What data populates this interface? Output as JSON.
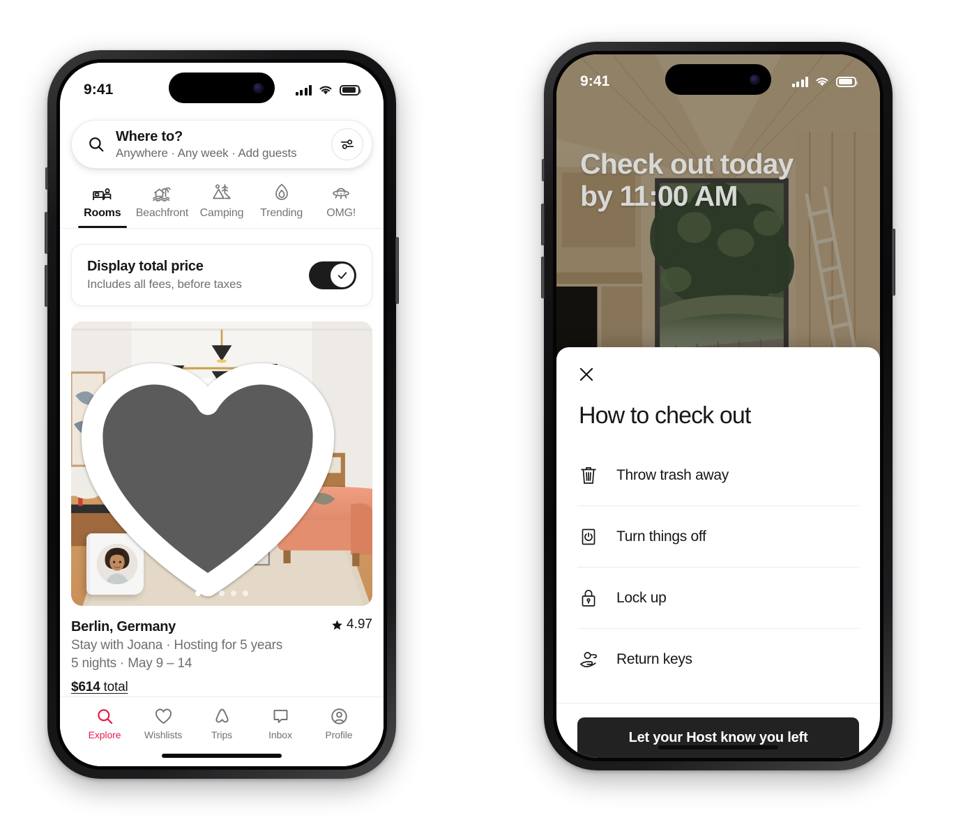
{
  "theme": {
    "brand": "#E61E4D",
    "ink": "#171717",
    "muted": "#6f6f6f",
    "cta_bg": "#222222"
  },
  "left_phone": {
    "status": {
      "time": "9:41",
      "signal_icon": "cellular-bars-icon",
      "wifi_icon": "wifi-icon",
      "battery_icon": "battery-icon"
    },
    "search": {
      "icon": "search-icon",
      "title": "Where to?",
      "subtitle": "Anywhere · Any week · Add guests",
      "filter_icon": "filter-sliders-icon"
    },
    "categories": [
      {
        "label": "Rooms",
        "icon": "bed-room-icon",
        "active": true
      },
      {
        "label": "Beachfront",
        "icon": "beachfront-icon",
        "active": false
      },
      {
        "label": "Camping",
        "icon": "camping-tent-icon",
        "active": false
      },
      {
        "label": "Trending",
        "icon": "flame-icon",
        "active": false
      },
      {
        "label": "OMG!",
        "icon": "ufo-icon",
        "active": false
      }
    ],
    "total_price_card": {
      "title": "Display total price",
      "subtitle": "Includes all fees, before taxes",
      "toggle_on": true,
      "toggle_icon": "check-icon"
    },
    "listing": {
      "photo_alt": "berlin-living-room-photo",
      "favorite_icon": "heart-filled-icon",
      "host_avatar": "host-avatar",
      "carousel_dots": 5,
      "carousel_active_index": 0,
      "place": "Berlin, Germany",
      "rating": "4.97",
      "rating_icon": "star-icon",
      "host_line": "Stay with Joana · Hosting for 5 years",
      "nights_line": "5 nights · May 9 – 14",
      "price_amount": "$614",
      "price_suffix": " total"
    },
    "tabs": [
      {
        "label": "Explore",
        "icon": "search-icon",
        "active": true
      },
      {
        "label": "Wishlists",
        "icon": "heart-outline-icon",
        "active": false
      },
      {
        "label": "Trips",
        "icon": "airbnb-belo-icon",
        "active": false
      },
      {
        "label": "Inbox",
        "icon": "chat-bubble-icon",
        "active": false
      },
      {
        "label": "Profile",
        "icon": "user-circle-icon",
        "active": false
      }
    ]
  },
  "right_phone": {
    "status": {
      "time": "9:41",
      "signal_icon": "cellular-bars-icon",
      "wifi_icon": "wifi-icon",
      "battery_icon": "battery-icon"
    },
    "background_alt": "cabin-interior-photo",
    "headline_line1": "Check out today",
    "headline_line2": "by 11:00 AM",
    "sheet": {
      "close_icon": "close-icon",
      "title": "How to check out",
      "steps": [
        {
          "label": "Throw trash away",
          "icon": "trash-icon"
        },
        {
          "label": "Turn things off",
          "icon": "power-switch-icon"
        },
        {
          "label": "Lock up",
          "icon": "lock-icon"
        },
        {
          "label": "Return keys",
          "icon": "hand-key-icon"
        }
      ],
      "cta_label": "Let your Host know you left"
    }
  }
}
